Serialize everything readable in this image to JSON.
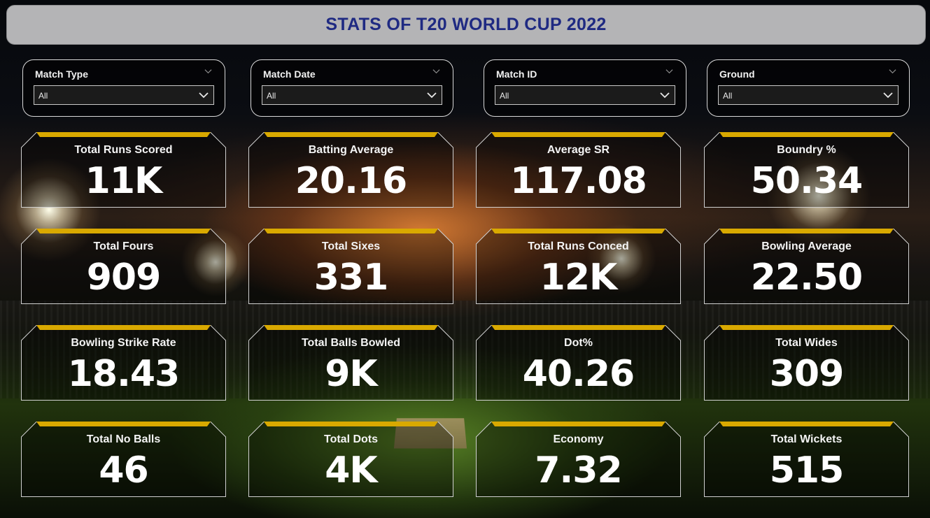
{
  "header": {
    "title": "STATS OF T20 WORLD CUP 2022"
  },
  "filters": [
    {
      "label": "Match Type",
      "value": "All"
    },
    {
      "label": "Match Date",
      "value": "All"
    },
    {
      "label": "Match ID",
      "value": "All"
    },
    {
      "label": "Ground",
      "value": "All"
    }
  ],
  "cards": [
    {
      "label": "Total Runs Scored",
      "value": "11K"
    },
    {
      "label": "Batting Average",
      "value": "20.16"
    },
    {
      "label": "Average SR",
      "value": "117.08"
    },
    {
      "label": "Boundry %",
      "value": "50.34"
    },
    {
      "label": "Total Fours",
      "value": "909"
    },
    {
      "label": "Total Sixes",
      "value": "331"
    },
    {
      "label": "Total Runs Conced",
      "value": "12K"
    },
    {
      "label": "Bowling Average",
      "value": "22.50"
    },
    {
      "label": "Bowling Strike Rate",
      "value": "18.43"
    },
    {
      "label": "Total Balls Bowled",
      "value": "9K"
    },
    {
      "label": "Dot%",
      "value": "40.26"
    },
    {
      "label": "Total Wides",
      "value": "309"
    },
    {
      "label": "Total No Balls",
      "value": "46"
    },
    {
      "label": "Total Dots",
      "value": "4K"
    },
    {
      "label": "Economy",
      "value": "7.32"
    },
    {
      "label": "Total Wickets",
      "value": "515"
    }
  ],
  "colors": {
    "title_text": "#1f2a82",
    "header_bg": "#b4b4b6",
    "card_accent": "#d9a900",
    "card_border": "#d0d0d0"
  },
  "icons": {
    "filter_menu": "chevron-down-icon",
    "dropdown": "chevron-down-icon"
  }
}
